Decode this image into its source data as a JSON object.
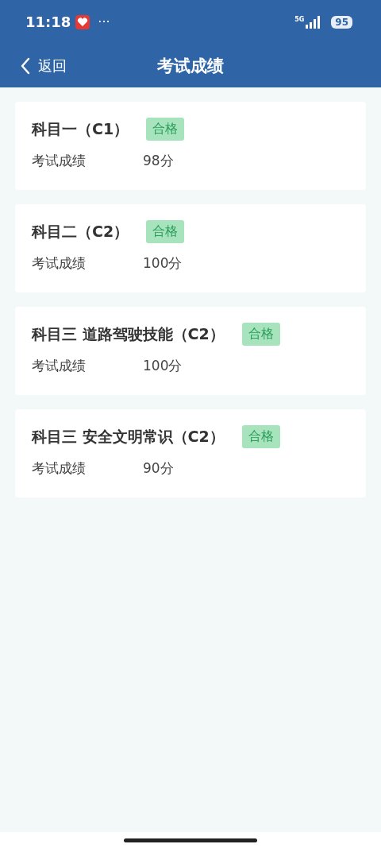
{
  "status_bar": {
    "time": "11:18",
    "more": "···",
    "network": "5G",
    "battery": "95"
  },
  "nav": {
    "back": "返回",
    "title": "考试成绩"
  },
  "results": [
    {
      "subject": "科目一（C1）",
      "badge": "合格",
      "label": "考试成绩",
      "score": "98分"
    },
    {
      "subject": "科目二（C2）",
      "badge": "合格",
      "label": "考试成绩",
      "score": "100分"
    },
    {
      "subject": "科目三 道路驾驶技能（C2）",
      "badge": "合格",
      "label": "考试成绩",
      "score": "100分"
    },
    {
      "subject": "科目三 安全文明常识（C2）",
      "badge": "合格",
      "label": "考试成绩",
      "score": "90分"
    }
  ]
}
